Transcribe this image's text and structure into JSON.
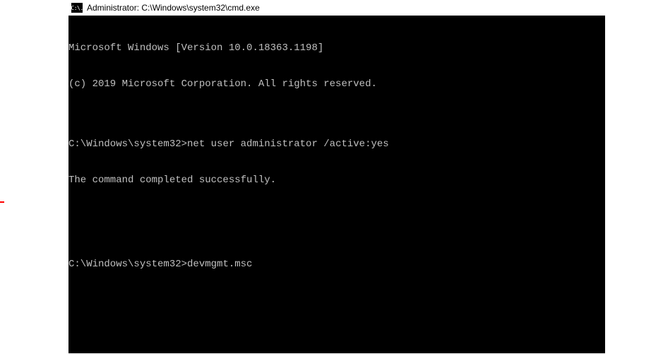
{
  "window": {
    "title": "Administrator: C:\\Windows\\system32\\cmd.exe",
    "icon_label": "C:\\."
  },
  "terminal": {
    "lines": {
      "version": "Microsoft Windows [Version 10.0.18363.1198]",
      "copyright": "(c) 2019 Microsoft Corporation. All rights reserved.",
      "blank1": "",
      "prompt1": "C:\\Windows\\system32>",
      "input1": "net user administrator /active:yes",
      "result1": "The command completed successfully.",
      "blank2": "",
      "blank3": "",
      "prompt2": "C:\\Windows\\system32>",
      "input2": "devmgmt.msc"
    }
  }
}
